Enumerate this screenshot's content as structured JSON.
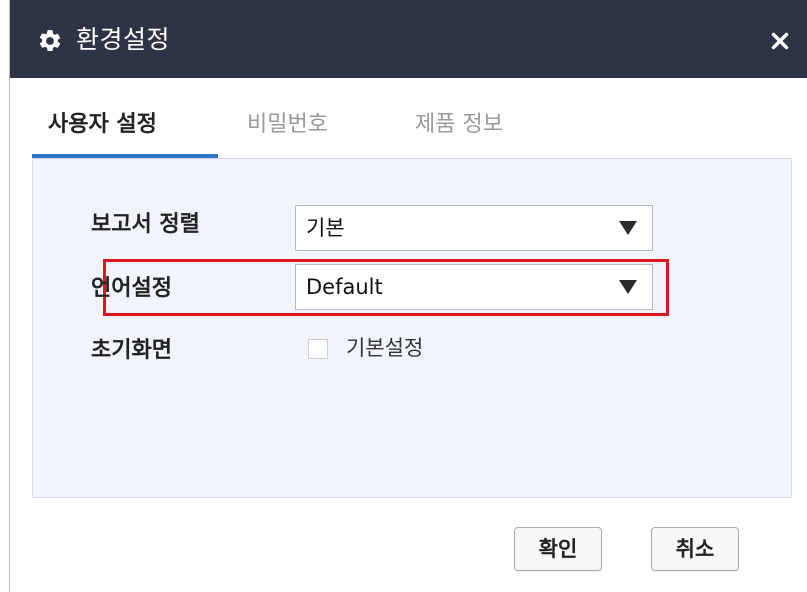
{
  "dialog": {
    "title": "환경설정",
    "title_icon": "gear-icon",
    "close_icon": "close-icon"
  },
  "tabs": [
    {
      "label": "사용자 설정",
      "active": true
    },
    {
      "label": "비밀번호",
      "active": false
    },
    {
      "label": "제품 정보",
      "active": false
    }
  ],
  "settings": {
    "report_sort": {
      "label": "보고서 정렬",
      "value": "기본"
    },
    "language": {
      "label": "언어설정",
      "value": "Default"
    },
    "home_screen": {
      "label": "초기화면",
      "checkbox_label": "기본설정",
      "checked": false
    }
  },
  "buttons": {
    "confirm": "확인",
    "cancel": "취소"
  },
  "colors": {
    "titlebar": "#2c3446",
    "tab_accent": "#2e74c9",
    "panel_bg": "#f1f3fd",
    "highlight": "#e0141c"
  }
}
